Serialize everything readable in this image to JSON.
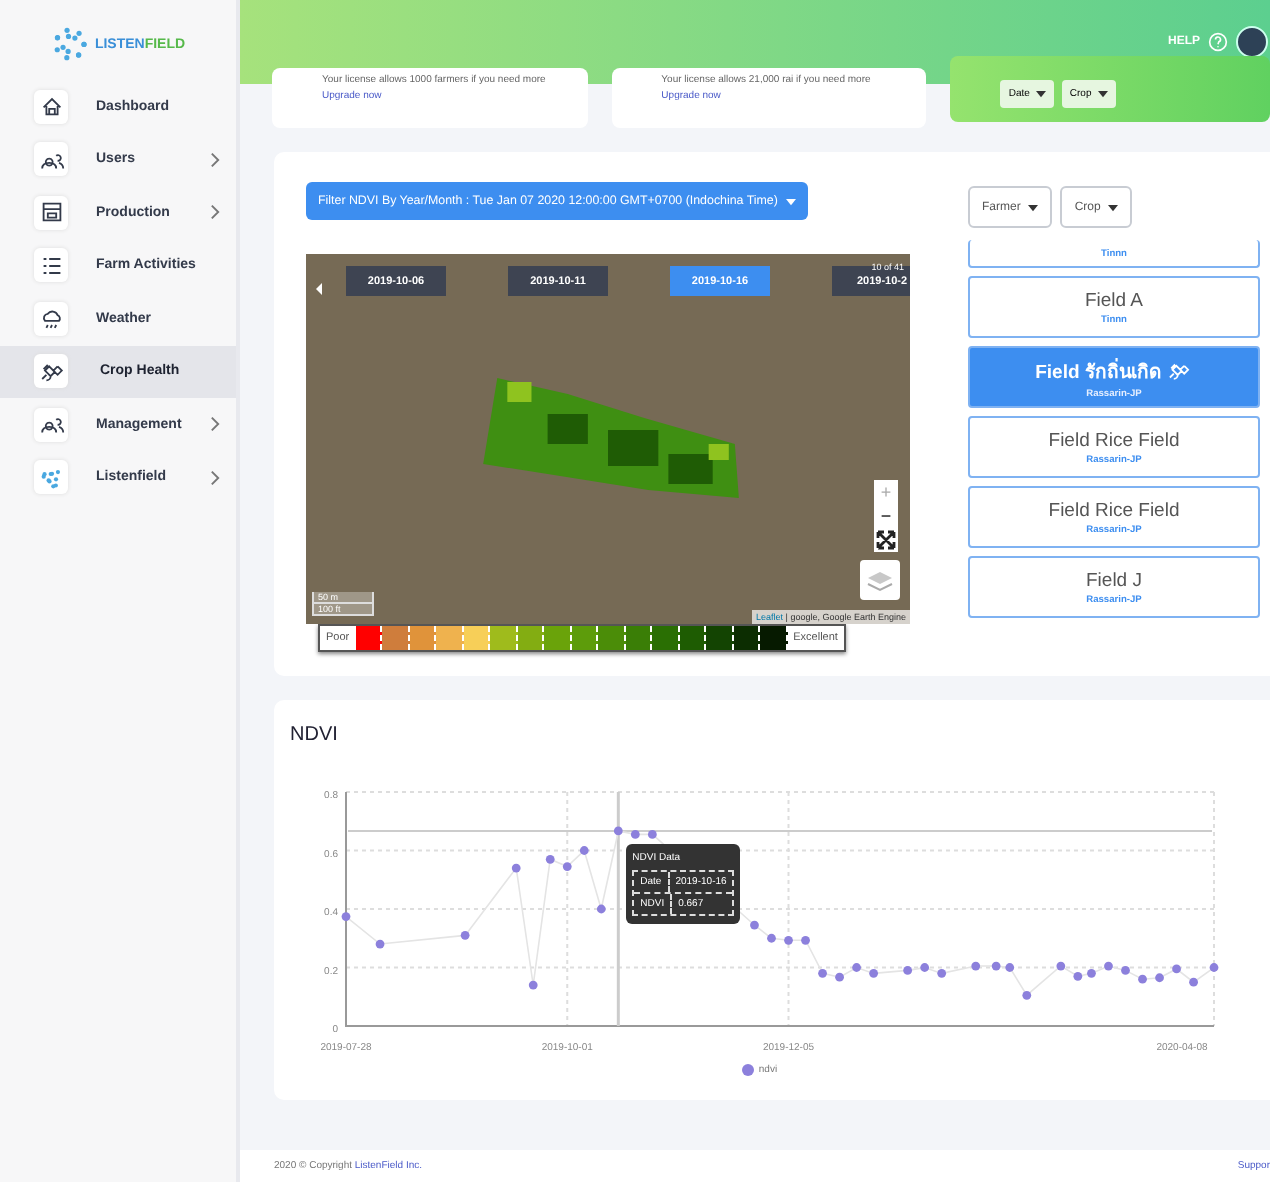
{
  "sidebar": {
    "logo": {
      "part_1": "LISTEN",
      "part_2": "FIELD"
    },
    "items": [
      {
        "label": "Dashboard",
        "expandable": false,
        "selected": false
      },
      {
        "label": "Users",
        "expandable": true,
        "selected": false
      },
      {
        "label": "Production",
        "expandable": true,
        "selected": false
      },
      {
        "label": "Farm Activities",
        "expandable": false,
        "selected": false
      },
      {
        "label": "Weather",
        "expandable": false,
        "selected": false
      },
      {
        "label": "Crop Health",
        "expandable": false,
        "selected": true
      },
      {
        "label": "Management",
        "expandable": true,
        "selected": false
      },
      {
        "label": "Listenfield",
        "expandable": true,
        "selected": false
      }
    ]
  },
  "header": {
    "help": "HELP"
  },
  "license_cards": [
    {
      "text": "Your license allows 1000 farmers if you need more ",
      "link": "Upgrade now"
    },
    {
      "text": "Your license allows 21,000 rai if you need more ",
      "link": "Upgrade now"
    }
  ],
  "filter_card": {
    "dropdowns": [
      "Date",
      "Crop"
    ]
  },
  "crop_health": {
    "filter_button": "Filter NDVI By Year/Month : Tue Jan 07 2020 12:00:00 GMT+0700 (Indochina Time)",
    "dropdowns": [
      "Farmer",
      "Crop"
    ],
    "map": {
      "dates": [
        {
          "label": "2019-10-06",
          "selected": false
        },
        {
          "label": "2019-10-11",
          "selected": false
        },
        {
          "label": "2019-10-16",
          "selected": true
        },
        {
          "label": "2019-10-2",
          "selected": false
        }
      ],
      "counter": "10 of 41",
      "zoom_in": "+",
      "zoom_out": "−",
      "scale": [
        "50 m",
        "100 ft"
      ],
      "attribution_link": "Leaflet",
      "attribution": " | google, Google Earth Engine"
    },
    "legend": {
      "low": "Poor",
      "high": "Excellent",
      "swatches": [
        {
          "color": "#ff0000"
        },
        {
          "color": "#cf7d3c"
        },
        {
          "color": "#e0933a"
        },
        {
          "color": "#efb24e"
        },
        {
          "color": "#f7cf58"
        },
        {
          "color": "#9fbb1c"
        },
        {
          "color": "#83ad12"
        },
        {
          "color": "#6aa30a"
        },
        {
          "color": "#5d9c0b"
        },
        {
          "color": "#4b8d08"
        },
        {
          "color": "#3a7e06"
        },
        {
          "color": "#2a6f03"
        },
        {
          "color": "#1e5c02"
        },
        {
          "color": "#134402"
        },
        {
          "color": "#0c2d01"
        },
        {
          "color": "#061a00"
        }
      ]
    },
    "fields": [
      {
        "owner": "Tinnn",
        "selected": false
      },
      {
        "name": "Field A",
        "owner": "Tinnn",
        "selected": false,
        "satellite": false
      },
      {
        "name": "Field รักถิ่นเกิด",
        "owner": "Rassarin-JP",
        "selected": true,
        "satellite": true
      },
      {
        "name": "Field Rice Field",
        "owner": "Rassarin-JP",
        "selected": false,
        "satellite": false
      },
      {
        "name": "Field Rice Field",
        "owner": "Rassarin-JP",
        "selected": false,
        "satellite": false
      },
      {
        "name": "Field J",
        "owner": "Rassarin-JP",
        "selected": false,
        "satellite": false
      }
    ]
  },
  "ndvi": {
    "title": "NDVI",
    "chart_data": {
      "type": "line",
      "x": [
        "2019-07-28",
        "2019-08-07",
        "2019-09-01",
        "2019-09-16",
        "2019-09-21",
        "2019-09-26",
        "2019-10-01",
        "2019-10-06",
        "2019-10-11",
        "2019-10-16",
        "2019-10-21",
        "2019-10-26",
        "2019-11-25",
        "2019-11-30",
        "2019-12-05",
        "2019-12-10",
        "2019-12-15",
        "2019-12-20",
        "2019-12-25",
        "2019-12-30",
        "2020-01-09",
        "2020-01-14",
        "2020-01-19",
        "2020-01-29",
        "2020-02-04",
        "2020-02-08",
        "2020-02-13",
        "2020-02-23",
        "2020-02-28",
        "2020-03-03",
        "2020-03-08",
        "2020-03-13",
        "2020-03-18",
        "2020-03-23",
        "2020-03-28",
        "2020-04-02",
        "2020-04-08"
      ],
      "grid": true,
      "ref_lines": [
        {
          "axis": "x",
          "value": "2019-10-16"
        },
        {
          "axis": "y",
          "value": 0.667
        }
      ],
      "series": [
        {
          "name": "ndvi",
          "color": "#8c80dc",
          "marker": "circle",
          "values": [
            0.374,
            0.28,
            0.31,
            0.54,
            0.14,
            0.57,
            0.545,
            0.6,
            0.4,
            0.667,
            0.655,
            0.655,
            0.345,
            0.3,
            0.293,
            0.293,
            0.18,
            0.167,
            0.2,
            0.18,
            0.19,
            0.2,
            0.18,
            0.205,
            0.205,
            0.2,
            0.105,
            0.205,
            0.17,
            0.18,
            0.205,
            0.19,
            0.16,
            0.165,
            0.195,
            0.15,
            0.2
          ]
        }
      ],
      "ylim": [
        0,
        0.8
      ],
      "yticks": [
        0,
        0.2,
        0.4,
        0.6,
        0.8
      ],
      "xlim": [
        "2019-07-28",
        "2020-04-08"
      ],
      "xticks": [
        "2019-07-28",
        "2019-10-01",
        "2019-12-05",
        "2020-04-08"
      ]
    },
    "tooltip": {
      "title": "NDVI Data",
      "rows": [
        {
          "label": "Date",
          "value": "2019-10-16"
        },
        {
          "label": "NDVI",
          "value": "0.667"
        }
      ]
    }
  },
  "footer": {
    "text": "2020 © Copyright ",
    "link": "ListenField Inc.",
    "support": "Suppor"
  }
}
